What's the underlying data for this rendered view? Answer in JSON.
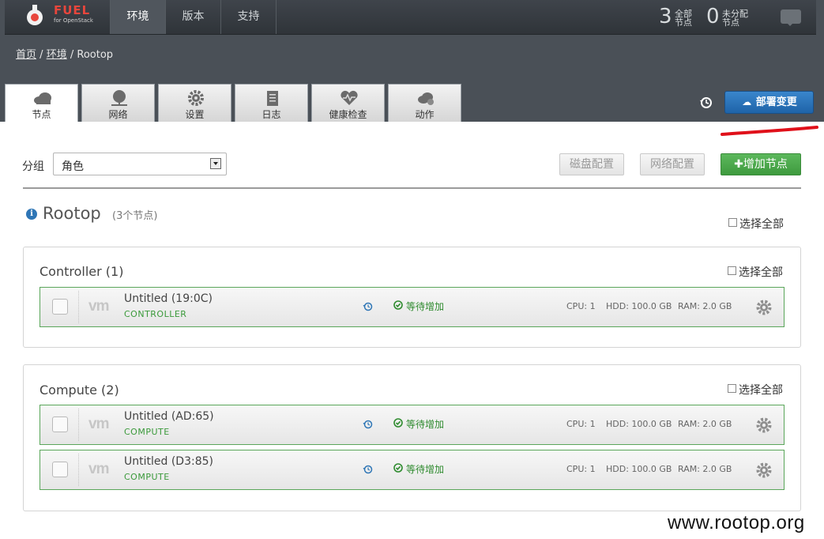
{
  "brand": {
    "name": "FUEL",
    "subtitle": "for OpenStack",
    "accent": "#e8463c"
  },
  "nav": {
    "tabs": [
      {
        "label": "环境",
        "active": true
      },
      {
        "label": "版本"
      },
      {
        "label": "支持"
      }
    ]
  },
  "stats": [
    {
      "value": "3",
      "label": "全部 节点"
    },
    {
      "value": "0",
      "label": "未分配 节点"
    }
  ],
  "breadcrumb": {
    "items": [
      "首页",
      "环境",
      "Rootop"
    ],
    "sep": "/"
  },
  "env_tabs": [
    {
      "label": "节点",
      "icon": "cloud-icon",
      "active": true
    },
    {
      "label": "网络",
      "icon": "network-icon"
    },
    {
      "label": "设置",
      "icon": "gear-icon"
    },
    {
      "label": "日志",
      "icon": "clipboard-icon"
    },
    {
      "label": "健康检查",
      "icon": "heart-pulse-icon"
    },
    {
      "label": "动作",
      "icon": "cloud-gears-icon"
    }
  ],
  "deploy": {
    "label": "部署变更",
    "color": "#2a74bb"
  },
  "toolbar": {
    "group_label": "分组",
    "group_value": "角色",
    "disk_config": "磁盘配置",
    "net_config": "网络配置",
    "add_node": "增加节点"
  },
  "env": {
    "name": "Rootop",
    "count_text": "(3个节点)",
    "select_all": "选择全部"
  },
  "groups": [
    {
      "title": "Controller (1)",
      "select_all": "选择全部",
      "nodes": [
        {
          "name": "Untitled (19:0C)",
          "role": "CONTROLLER",
          "status": "等待增加",
          "cpu": "CPU: 1",
          "hdd": "HDD: 100.0 GB",
          "ram": "RAM: 2.0 GB"
        }
      ]
    },
    {
      "title": "Compute (2)",
      "select_all": "选择全部",
      "nodes": [
        {
          "name": "Untitled (AD:65)",
          "role": "COMPUTE",
          "status": "等待增加",
          "cpu": "CPU: 1",
          "hdd": "HDD: 100.0 GB",
          "ram": "RAM: 2.0 GB"
        },
        {
          "name": "Untitled (D3:85)",
          "role": "COMPUTE",
          "status": "等待增加",
          "cpu": "CPU: 1",
          "hdd": "HDD: 100.0 GB",
          "ram": "RAM: 2.0 GB"
        }
      ]
    }
  ],
  "watermark": "www.rootop.org",
  "colors": {
    "status_green": "#2f8b2f",
    "add_green": "#4cae4c",
    "info_blue": "#2f76b6"
  }
}
